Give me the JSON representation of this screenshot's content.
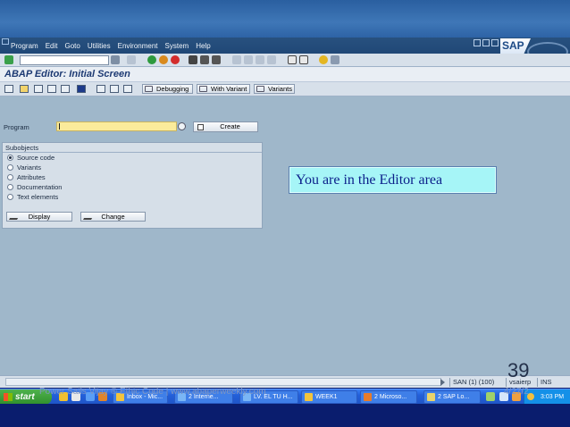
{
  "menu": {
    "items": [
      "Program",
      "Edit",
      "Goto",
      "Utilities",
      "Environment",
      "System",
      "Help"
    ],
    "logo": "SAP"
  },
  "screen": {
    "title": "ABAP Editor: Initial Screen"
  },
  "app_toolbar": {
    "debugging": "Debugging",
    "with_variant": "With Variant",
    "variants": "Variants"
  },
  "program": {
    "label": "Program",
    "value": "",
    "create_label": "Create"
  },
  "subobjects": {
    "title": "Subobjects",
    "options": [
      "Source code",
      "Variants",
      "Attributes",
      "Documentation",
      "Text elements"
    ],
    "selected": "Source code",
    "display_label": "Display",
    "change_label": "Change"
  },
  "callout": {
    "text": "You are in the Editor area"
  },
  "status_bar": {
    "system": "SAN (1) (100)",
    "server": "vsaierp",
    "mode": "INS"
  },
  "slide": {
    "page_number": "39",
    "footer": "Power Sails Vijay ®  Ethic Code  |  www.abaperweekly.com",
    "date": "4/27/2"
  },
  "taskbar": {
    "start": "start",
    "tasks": [
      "Inbox - Mic...",
      "2 Interne...",
      "LV. EL TU H...",
      "WEEK1",
      "2 Microso...",
      "2 SAP Lo..."
    ],
    "clock": "3:03 PM"
  },
  "colors": {
    "accent": "#1d3a73",
    "workarea": "#9fb7ca",
    "input_highlight": "#fbeb9b",
    "callout": "#a6f5f7"
  }
}
